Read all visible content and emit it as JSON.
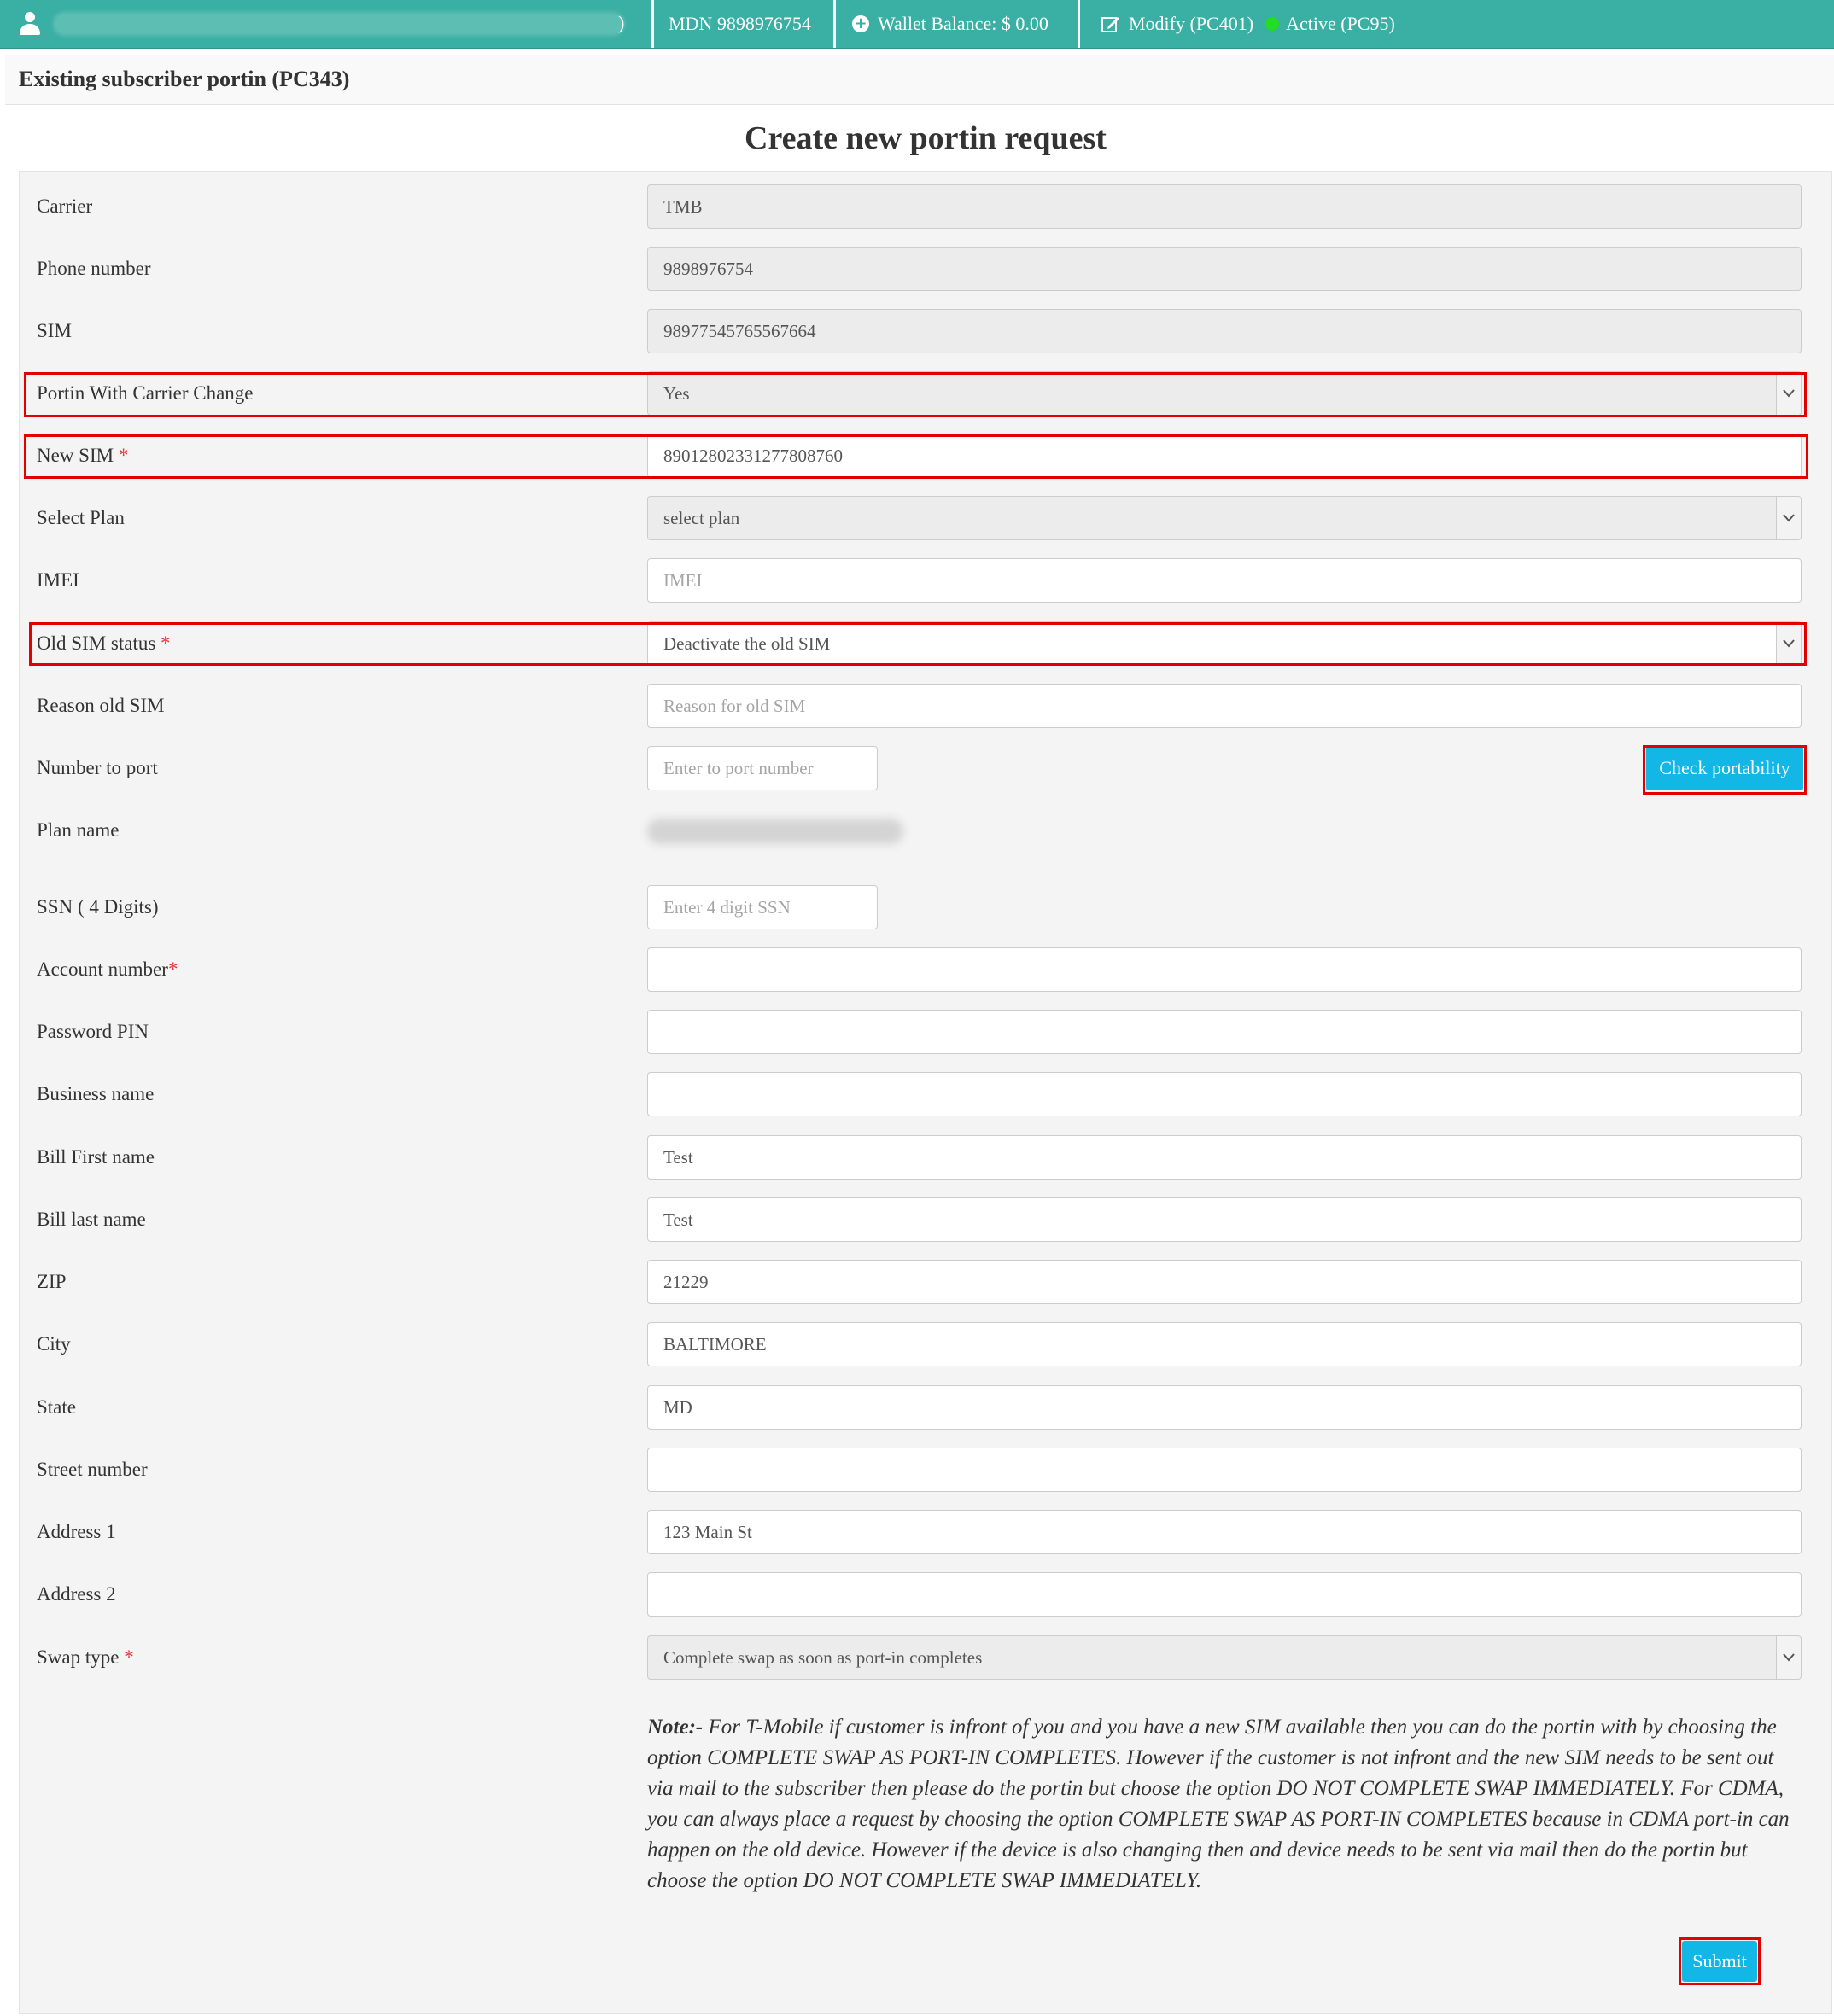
{
  "topbar": {
    "user_suffix": ")",
    "mdn": "MDN 9898976754",
    "wallet": "Wallet Balance: $ 0.00",
    "modify": "Modify (PC401)",
    "status": "Active (PC95)"
  },
  "subheader": {
    "title": "Existing subscriber portin (PC343)"
  },
  "form": {
    "heading": "Create new portin request",
    "carrier": {
      "label": "Carrier",
      "value": "TMB"
    },
    "phone": {
      "label": "Phone number",
      "value": "9898976754"
    },
    "sim": {
      "label": "SIM",
      "value": "98977545765567664"
    },
    "carrier_change": {
      "label": "Portin With Carrier Change",
      "value": "Yes"
    },
    "new_sim": {
      "label": "New SIM",
      "required": "*",
      "value": "89012802331277808760"
    },
    "plan": {
      "label": "Select Plan",
      "value": "select plan"
    },
    "imei": {
      "label": "IMEI",
      "placeholder": "IMEI"
    },
    "old_sim_status": {
      "label": "Old SIM status",
      "required": "*",
      "value": "Deactivate the old SIM"
    },
    "reason_old_sim": {
      "label": "Reason old SIM",
      "placeholder": "Reason for old SIM"
    },
    "number_to_port": {
      "label": "Number to port",
      "placeholder": "Enter to port number"
    },
    "check_button": "Check portability",
    "plan_name": {
      "label": "Plan name"
    },
    "ssn": {
      "label": "SSN ( 4 Digits)",
      "placeholder": "Enter 4 digit SSN"
    },
    "account_number": {
      "label": "Account number",
      "required": "*",
      "value": ""
    },
    "password_pin": {
      "label": "Password PIN",
      "value": ""
    },
    "business_name": {
      "label": "Business name",
      "value": ""
    },
    "bill_first_name": {
      "label": "Bill First name",
      "value": "Test"
    },
    "bill_last_name": {
      "label": "Bill last name",
      "value": "Test"
    },
    "zip": {
      "label": "ZIP",
      "value": "21229"
    },
    "city": {
      "label": "City",
      "value": "BALTIMORE"
    },
    "state": {
      "label": "State",
      "value": "MD"
    },
    "street_number": {
      "label": "Street number",
      "value": ""
    },
    "address1": {
      "label": "Address 1",
      "value": "123 Main St"
    },
    "address2": {
      "label": "Address 2",
      "value": ""
    },
    "swap_type": {
      "label": "Swap type",
      "required": "*",
      "value": "Complete swap as soon as port-in completes"
    },
    "note_title": "Note:-",
    "note_body": "For T-Mobile if customer is infront of you and you have a new SIM available then you can do the portin with by choosing the option COMPLETE SWAP AS PORT-IN COMPLETES. However if the customer is not infront and the new SIM needs to be sent out via mail to the subscriber then please do the portin but choose the option DO NOT COMPLETE SWAP IMMEDIATELY. For CDMA, you can always place a request by choosing the option COMPLETE SWAP AS PORT-IN COMPLETES because in CDMA port-in can happen on the old device. However if the device is also changing then and device needs to be sent via mail then do the portin but choose the option DO NOT COMPLETE SWAP IMMEDIATELY.",
    "submit": "Submit"
  },
  "colors": {
    "topbar": "#3ab0a4",
    "button": "#12b7e6",
    "highlight": "#e30000",
    "required": "#e03a3a"
  },
  "icons": [
    "user-icon",
    "plus-circle-icon",
    "edit-icon",
    "status-dot-icon",
    "chevron-down-icon"
  ]
}
